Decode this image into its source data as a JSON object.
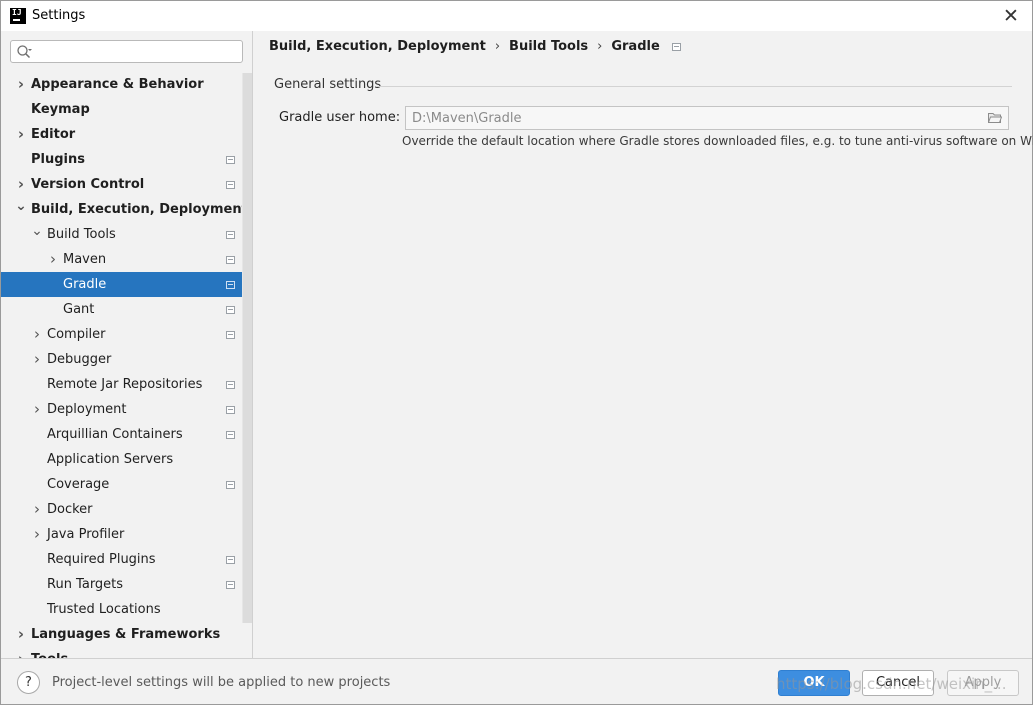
{
  "window": {
    "title": "Settings",
    "app_icon_text": "IJ"
  },
  "search": {
    "placeholder": ""
  },
  "tree": [
    {
      "label": "Appearance & Behavior",
      "level": 0,
      "bold": true,
      "chevron": "right",
      "page_icon": false
    },
    {
      "label": "Keymap",
      "level": 0,
      "bold": true,
      "chevron": "none",
      "page_icon": false
    },
    {
      "label": "Editor",
      "level": 0,
      "bold": true,
      "chevron": "right",
      "page_icon": false
    },
    {
      "label": "Plugins",
      "level": 0,
      "bold": true,
      "chevron": "none",
      "page_icon": true
    },
    {
      "label": "Version Control",
      "level": 0,
      "bold": true,
      "chevron": "right",
      "page_icon": true
    },
    {
      "label": "Build, Execution, Deployment",
      "level": 0,
      "bold": true,
      "chevron": "down",
      "page_icon": false
    },
    {
      "label": "Build Tools",
      "level": 1,
      "bold": false,
      "chevron": "down",
      "page_icon": true
    },
    {
      "label": "Maven",
      "level": 2,
      "bold": false,
      "chevron": "right",
      "page_icon": true
    },
    {
      "label": "Gradle",
      "level": 2,
      "bold": false,
      "chevron": "none",
      "page_icon": true,
      "selected": true
    },
    {
      "label": "Gant",
      "level": 2,
      "bold": false,
      "chevron": "none",
      "page_icon": true
    },
    {
      "label": "Compiler",
      "level": 1,
      "bold": false,
      "chevron": "right",
      "page_icon": true
    },
    {
      "label": "Debugger",
      "level": 1,
      "bold": false,
      "chevron": "right",
      "page_icon": false
    },
    {
      "label": "Remote Jar Repositories",
      "level": 1,
      "bold": false,
      "chevron": "none",
      "page_icon": true
    },
    {
      "label": "Deployment",
      "level": 1,
      "bold": false,
      "chevron": "right",
      "page_icon": true
    },
    {
      "label": "Arquillian Containers",
      "level": 1,
      "bold": false,
      "chevron": "none",
      "page_icon": true
    },
    {
      "label": "Application Servers",
      "level": 1,
      "bold": false,
      "chevron": "none",
      "page_icon": false
    },
    {
      "label": "Coverage",
      "level": 1,
      "bold": false,
      "chevron": "none",
      "page_icon": true
    },
    {
      "label": "Docker",
      "level": 1,
      "bold": false,
      "chevron": "right",
      "page_icon": false
    },
    {
      "label": "Java Profiler",
      "level": 1,
      "bold": false,
      "chevron": "right",
      "page_icon": false
    },
    {
      "label": "Required Plugins",
      "level": 1,
      "bold": false,
      "chevron": "none",
      "page_icon": true
    },
    {
      "label": "Run Targets",
      "level": 1,
      "bold": false,
      "chevron": "none",
      "page_icon": true
    },
    {
      "label": "Trusted Locations",
      "level": 1,
      "bold": false,
      "chevron": "none",
      "page_icon": false
    },
    {
      "label": "Languages & Frameworks",
      "level": 0,
      "bold": true,
      "chevron": "right",
      "page_icon": false
    },
    {
      "label": "Tools",
      "level": 0,
      "bold": true,
      "chevron": "right",
      "page_icon": false
    }
  ],
  "breadcrumb": {
    "items": [
      "Build, Execution, Deployment",
      "Build Tools",
      "Gradle"
    ],
    "separator": "›"
  },
  "content": {
    "section_title": "General settings",
    "gradle_home_label": "Gradle user home:",
    "gradle_home_value": "D:\\Maven\\Gradle",
    "hint": "Override the default location where Gradle stores downloaded files, e.g. to tune anti-virus software on Windows"
  },
  "footer": {
    "help_label": "?",
    "status": "Project-level settings will be applied to new projects",
    "ok_label": "OK",
    "cancel_label": "Cancel",
    "apply_label": "Apply"
  },
  "watermark": "https://blog.csdn.net/weixin_...",
  "colors": {
    "selection": "#2675bf",
    "ok_button": "#3d8ee0",
    "background": "#f2f2f2"
  }
}
